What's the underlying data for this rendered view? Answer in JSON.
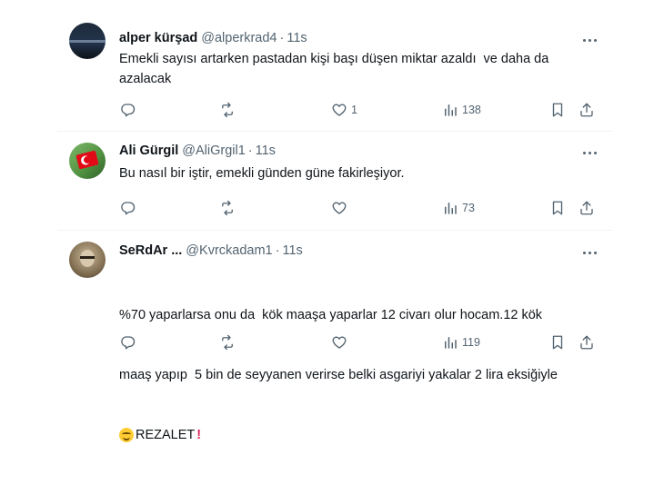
{
  "tweets": [
    {
      "name": "alper kürşad",
      "handle": "@alperkrad4",
      "time": "11s",
      "text": "Emekli sayısı artarken pastadan kişi başı düşen miktar azaldı  ve daha da azalacak",
      "likes": "1",
      "views": "138",
      "replies": "",
      "retweets": ""
    },
    {
      "name": "Ali Gürgil",
      "handle": "@AliGrgil1",
      "time": "11s",
      "text": "Bu nasıl bir iştir, emekli günden güne fakirleşiyor.",
      "likes": "",
      "views": "73",
      "replies": "",
      "retweets": ""
    },
    {
      "name": "SeRdAr ...",
      "handle": "@Kvrckadam1",
      "time": "11s",
      "text_line1": "%70 yaparlarsa onu da  kök maaşa yaparlar 12 civarı olur hocam.12 kök",
      "text_line2": "maaş yapıp  5 bin de seyyanen verirse belki asgariyi yakalar 2 lira eksiğiyle",
      "text_line3": "REZALET",
      "likes": "",
      "views": "119",
      "replies": "",
      "retweets": ""
    }
  ],
  "icons": {
    "reply": "reply-icon",
    "retweet": "retweet-icon",
    "like": "heart-icon",
    "views": "views-icon",
    "bookmark": "bookmark-icon",
    "share": "share-icon",
    "more": "more-icon"
  },
  "colors": {
    "text": "#0f1419",
    "muted": "#536471",
    "divider": "#eff3f4"
  }
}
